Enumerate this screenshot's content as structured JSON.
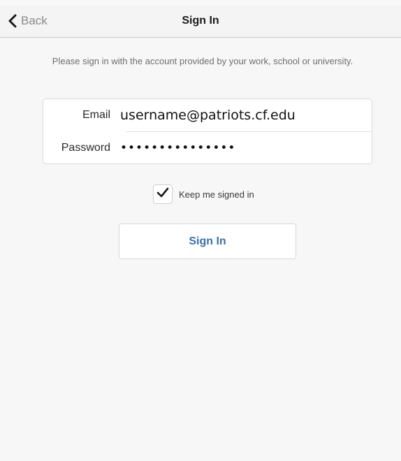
{
  "navbar": {
    "back_label": "Back",
    "title": "Sign In"
  },
  "intro": {
    "text": "Please sign in with the account provided by your work, school or university."
  },
  "form": {
    "email_label": "Email",
    "email_value": "username@patriots.cf.edu",
    "password_label": "Password",
    "password_masked": "•••••••••••••••"
  },
  "keep_signed_in": {
    "label": "Keep me signed in",
    "checked": true
  },
  "signin_button": {
    "label": "Sign In"
  },
  "colors": {
    "accent": "#3a6fb0",
    "background": "#f7f7f8",
    "navbar": "#f4f4f5"
  },
  "icons": {
    "back": "chevron-left-icon",
    "checkbox": "checkmark-icon"
  }
}
